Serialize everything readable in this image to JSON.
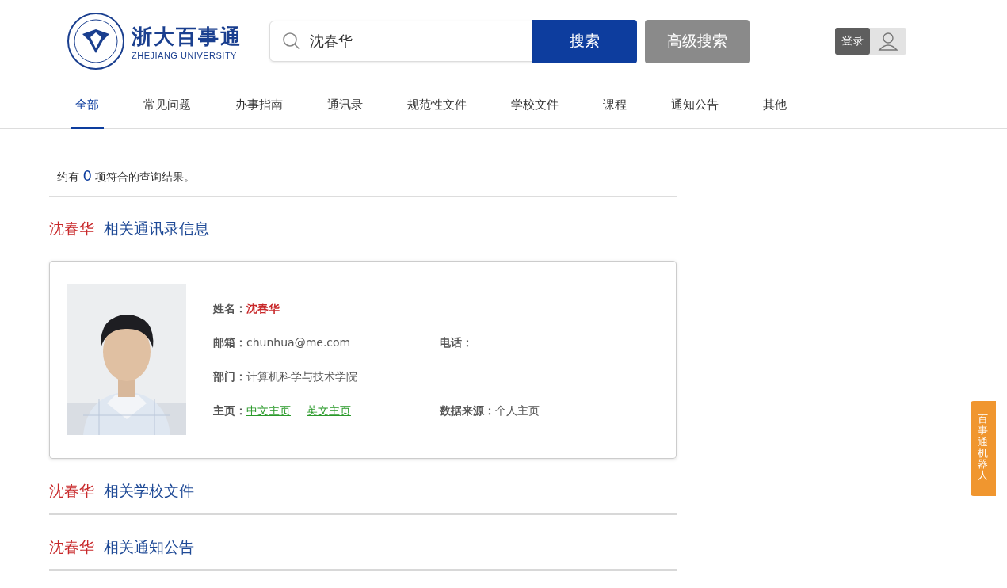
{
  "logo": {
    "title": "浙大百事通",
    "subtitle": "ZHEJIANG UNIVERSITY"
  },
  "search": {
    "value": "沈春华",
    "button": "搜索",
    "advanced": "高级搜索"
  },
  "login": {
    "label": "登录"
  },
  "tabs": [
    {
      "label": "全部",
      "selected": true
    },
    {
      "label": "常见问题",
      "selected": false
    },
    {
      "label": "办事指南",
      "selected": false
    },
    {
      "label": "通讯录",
      "selected": false
    },
    {
      "label": "规范性文件",
      "selected": false
    },
    {
      "label": "学校文件",
      "selected": false
    },
    {
      "label": "课程",
      "selected": false
    },
    {
      "label": "通知公告",
      "selected": false
    },
    {
      "label": "其他",
      "selected": false
    }
  ],
  "result_summary": {
    "prefix": "约有",
    "count": "0",
    "suffix": "项符合的查询结果。"
  },
  "sections": [
    {
      "query": "沈春华",
      "title": "相关通讯录信息",
      "kind": "contacts",
      "contact": {
        "fields": [
          {
            "label": "姓名：",
            "value": "沈春华"
          },
          {
            "label": "邮箱：",
            "value": "chunhua@me.com"
          },
          {
            "label": "电话："
          },
          {
            "label": "部门：",
            "value": "计算机科学与技术学院"
          },
          {
            "label": "主页：",
            "links": [
              "中文主页",
              "英文主页"
            ]
          },
          {
            "label": "数据来源：",
            "value": "个人主页"
          }
        ]
      }
    },
    {
      "query": "沈春华",
      "title": "相关学校文件",
      "kind": "empty"
    },
    {
      "query": "沈春华",
      "title": "相关通知公告",
      "kind": "empty"
    }
  ],
  "robot": {
    "label": "百事通机器人"
  }
}
